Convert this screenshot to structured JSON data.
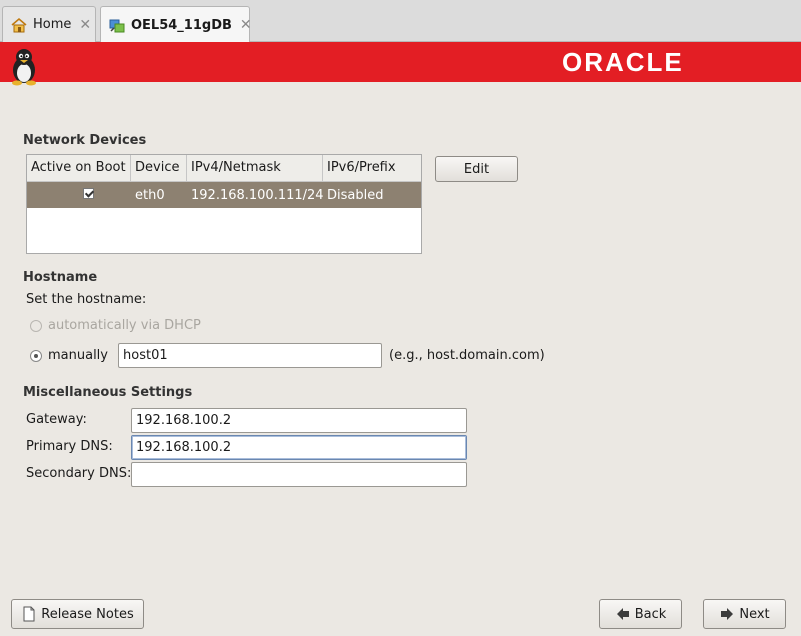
{
  "tabs": [
    {
      "label": "Home",
      "icon": "home-icon"
    },
    {
      "label": "OEL54_11gDB",
      "icon": "vm-icon"
    }
  ],
  "banner": {
    "brand": "ORACLE",
    "color": "#e31e24"
  },
  "network": {
    "heading": "Network Devices",
    "columns": [
      "Active on Boot",
      "Device",
      "IPv4/Netmask",
      "IPv6/Prefix"
    ],
    "rows": [
      {
        "active_on_boot": true,
        "device": "eth0",
        "ipv4": "192.168.100.111/24",
        "ipv6": "Disabled"
      }
    ],
    "edit_label": "Edit"
  },
  "hostname": {
    "heading": "Hostname",
    "prompt": "Set the hostname:",
    "auto_label": "automatically via DHCP",
    "manual_label": "manually",
    "value": "host01",
    "hint": "(e.g., host.domain.com)"
  },
  "misc": {
    "heading": "Miscellaneous Settings",
    "gateway_label": "Gateway:",
    "gateway_value": "192.168.100.2",
    "primary_dns_label": "Primary DNS:",
    "primary_dns_value": "192.168.100.2",
    "secondary_dns_label": "Secondary DNS:",
    "secondary_dns_value": ""
  },
  "footer": {
    "release_notes_label": "Release Notes",
    "back_label": "Back",
    "next_label": "Next"
  }
}
